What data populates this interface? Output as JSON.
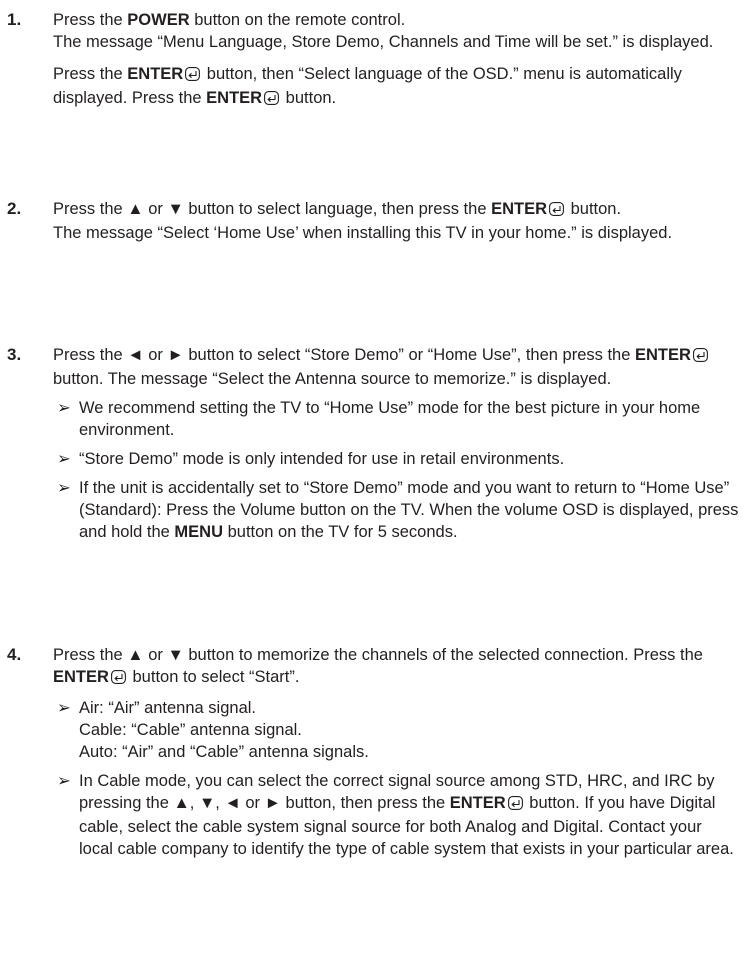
{
  "steps": [
    {
      "number": "1.",
      "lines": {
        "a1": "Press the ",
        "a2": "POWER",
        "a3": " button on the remote control.",
        "b": "The message “Menu Language, Store Demo, Channels and Time will be set.” is displayed.",
        "c1": "Press the ",
        "c2": "ENTER",
        "c3": " button, then “Select language of the OSD.” menu is automatically displayed. Press the ",
        "c4": "ENTER",
        "c5": " button."
      }
    },
    {
      "number": "2.",
      "lines": {
        "a1": "Press the ▲ or ▼ button to select language, then press the ",
        "a2": "ENTER",
        "a3": " button.",
        "b": "The message “Select ‘Home Use’ when installing this TV in your home.” is displayed."
      }
    },
    {
      "number": "3.",
      "lines": {
        "a1": "Press the ◄ or ► button to select “Store Demo” or “Home Use”, then press the ",
        "a2": "ENTER",
        "a3": " button. The message “Select the Antenna source to memorize.” is displayed."
      },
      "bullets": {
        "b1": "We recommend setting the TV to “Home Use” mode for the best picture in your home environment.",
        "b2": "“Store Demo” mode is only intended for use in retail environments.",
        "b3a": "If the unit is accidentally set to “Store Demo” mode and you want to return to “Home Use” (Standard): Press the Volume button on the TV. When the volume OSD is displayed, press and hold the ",
        "b3b": "MENU",
        "b3c": " button on the TV for 5 seconds."
      }
    },
    {
      "number": "4.",
      "lines": {
        "a1": "Press the ▲ or ▼ button to memorize the channels of the selected connection. Press the ",
        "a2": "ENTER",
        "a3": " button to select “Start”."
      },
      "bullets": {
        "b1l1": "Air: “Air” antenna signal.",
        "b1l2": "Cable: “Cable” antenna signal.",
        "b1l3": "Auto: “Air” and “Cable” antenna signals.",
        "b2a": "In Cable mode, you can select the correct signal source among STD, HRC, and IRC by pressing the ▲, ▼, ◄ or ► button, then press the ",
        "b2b": "ENTER",
        "b2c": " button. If you have Digital cable, select the cable system signal source for both Analog and Digital. Contact your local cable company to identify the type of cable system that exists in your particular area."
      }
    }
  ],
  "bullet_marker": "➢",
  "icons": {
    "enter": "enter-icon"
  }
}
